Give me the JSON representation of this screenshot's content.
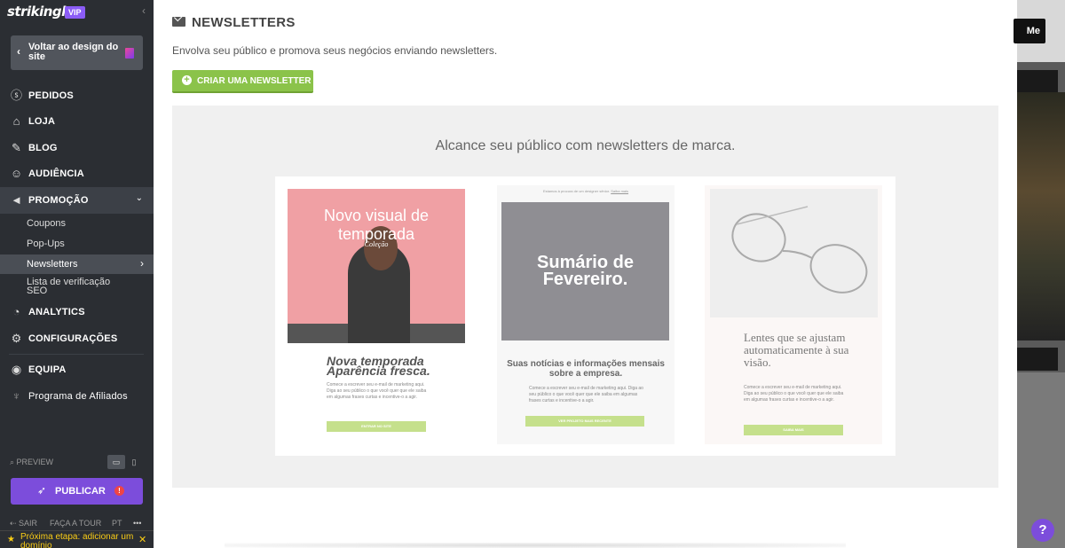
{
  "sidebar": {
    "logo": "strikingly",
    "vip": "VIP",
    "back_label": "Voltar ao design do site",
    "nav": [
      {
        "label": "PEDIDOS",
        "icon": "dollar-circle-icon"
      },
      {
        "label": "LOJA",
        "icon": "store-icon"
      },
      {
        "label": "BLOG",
        "icon": "feather-icon"
      },
      {
        "label": "AUDIÊNCIA",
        "icon": "users-icon"
      },
      {
        "label": "PROMOÇÃO",
        "icon": "megaphone-icon"
      }
    ],
    "promo_sub": [
      "Coupons",
      "Pop-Ups",
      "Newsletters",
      "Lista de verificação SEO"
    ],
    "nav2": [
      {
        "label": "ANALYTICS",
        "icon": "chart-icon"
      },
      {
        "label": "CONFIGURAÇÕES",
        "icon": "gear-icon"
      }
    ],
    "team_label": "EQUIPA",
    "affiliate_label": "Programa de Afiliados",
    "preview_label": "PREVIEW",
    "publish_label": "PUBLICAR",
    "footer": {
      "exit": "SAIR",
      "tour": "FAÇA A TOUR",
      "lang": "PT",
      "more": "•••"
    },
    "next_step": "Próxima etapa: adicionar um domínio"
  },
  "main": {
    "title": "NEWSLETTERS",
    "description": "Envolva seu público e promova seus negócios enviando newsletters.",
    "create_button": "CRIAR UMA NEWSLETTER",
    "promo_heading": "Alcance seu público com newsletters de marca.",
    "card1": {
      "image_title": "Novo visual de temporada",
      "image_sub": "Coleção",
      "heading": "Nova temporada Aparência fresca.",
      "body": "Comece a escrever seu e-mail de marketing aqui. Diga ao seu público o que você quer que ele saiba em algumas frases curtas e incentive-o a agir.",
      "button": "ENTRAR NO SITE"
    },
    "card2": {
      "top": "Estamos à procura de um designer sênior.",
      "top_link": "Saiba mais",
      "image_title": "Sumário de Fevereiro.",
      "heading": "Suas notícias e informações mensais sobre a empresa.",
      "body": "Comece a escrever seu e-mail de marketing aqui. Diga ao seu público o que você quer que ele saiba em algumas frases curtas e incentive-o a agir.",
      "button": "VER PROJETO MAIS RECENTE"
    },
    "card3": {
      "heading": "Lentes que se ajustam automaticamente à sua visão.",
      "body": "Comece a escrever seu e-mail de marketing aqui. Diga ao seu público o que você quer que ele saiba em algumas frases curtas e incentive-o a agir.",
      "button": "SAIBA MAIS"
    }
  },
  "background": {
    "button_fragment": "Me",
    "help": "?"
  },
  "colors": {
    "sidebar": "#2b2e33",
    "accent_green": "#8bc34a",
    "accent_purple": "#7c4ddb"
  }
}
